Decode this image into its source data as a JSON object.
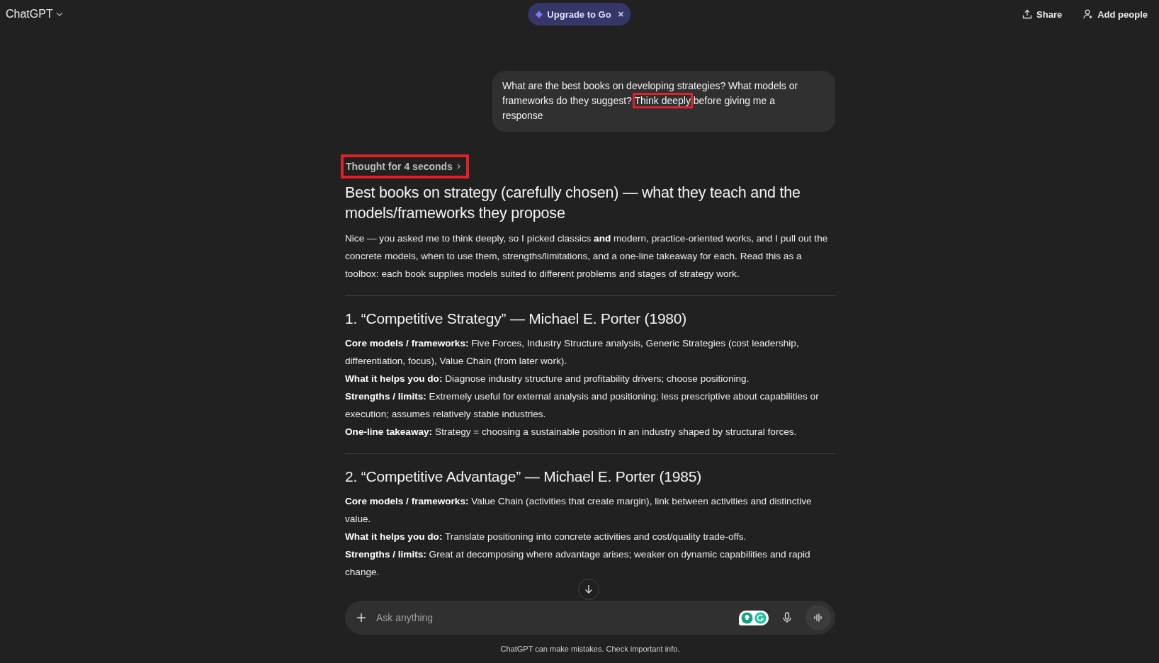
{
  "header": {
    "title": "ChatGPT",
    "upgrade": {
      "label": "Upgrade to Go"
    },
    "actions": [
      "Share",
      "Add people"
    ]
  },
  "user_message": {
    "segments": [
      {
        "text": "What are the best books on developing strategies? What models or frameworks do they suggest? ",
        "highlighted": false
      },
      {
        "text": "Think deeply",
        "highlighted": true
      },
      {
        "text": " before giving me a response",
        "highlighted": false
      }
    ]
  },
  "thought": {
    "label": "Thought for 4 seconds",
    "highlighted": true
  },
  "response": {
    "title": "Best books on strategy (carefully chosen) — what they teach and the models/frameworks they propose",
    "intro": "Nice — you asked me to think deeply, so I picked classics **and** modern, practice-oriented works, and I pull out the concrete models, when to use them, strengths/limitations, and a one-line takeaway for each. Read this as a toolbox: each book supplies models suited to different problems and stages of strategy work.",
    "sections": [
      {
        "heading": "1. “Competitive Strategy” — Michael E. Porter (1980)",
        "items": [
          "**Core models / frameworks:** Five Forces, Industry Structure analysis, Generic Strategies (cost leadership, differentiation, focus), Value Chain (from later work).",
          "**What it helps you do:** Diagnose industry structure and profitability drivers; choose positioning.",
          "**Strengths / limits:** Extremely useful for external analysis and positioning; less prescriptive about capabilities or execution; assumes relatively stable industries.",
          "**One-line takeaway:** Strategy = choosing a sustainable position in an industry shaped by structural forces."
        ]
      },
      {
        "heading": "2. “Competitive Advantage” — Michael E. Porter (1985)",
        "items": [
          "**Core models / frameworks:** Value Chain (activities that create margin), link between activities and distinctive value.",
          "**What it helps you do:** Translate positioning into concrete activities and cost/quality trade-offs.",
          "**Strengths / limits:** Great at decomposing where advantage arises; weaker on dynamic capabilities and rapid change."
        ]
      }
    ]
  },
  "composer": {
    "placeholder": "Ask anything"
  },
  "footer": "ChatGPT can make mistakes. Check important info."
}
